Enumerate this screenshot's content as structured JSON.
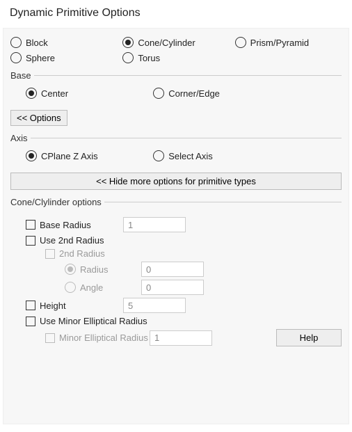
{
  "title": "Dynamic Primitive Options",
  "shapes": {
    "block": "Block",
    "cone": "Cone/Cylinder",
    "prism": "Prism/Pyramid",
    "sphere": "Sphere",
    "torus": "Torus",
    "selected": "cone"
  },
  "base": {
    "legend": "Base",
    "center": "Center",
    "corner": "Corner/Edge",
    "selected": "center"
  },
  "options_btn": "<<  Options",
  "axis": {
    "legend": "Axis",
    "cplane": "CPlane Z Axis",
    "select": "Select Axis",
    "selected": "cplane"
  },
  "hide_more": "<< Hide more options for primitive types",
  "cone_opts": {
    "legend": "Cone/Clylinder options",
    "base_radius_label": "Base Radius",
    "base_radius_value": "1",
    "use_2nd": "Use 2nd Radius",
    "second_radius_label": "2nd Radius",
    "radius_label": "Radius",
    "radius_value": "0",
    "angle_label": "Angle",
    "angle_value": "0",
    "height_label": "Height",
    "height_value": "5",
    "use_minor": "Use Minor Elliptical Radius",
    "minor_label": "Minor Elliptical Radius",
    "minor_value": "1"
  },
  "help": "Help"
}
